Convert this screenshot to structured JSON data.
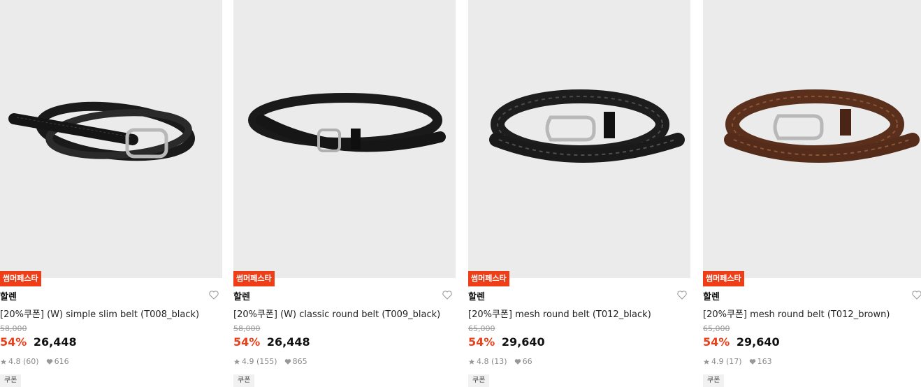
{
  "products": [
    {
      "badge": "썸머페스타",
      "brand": "할렌",
      "name": "[20%쿠폰] (W) simple slim belt (T008_black)",
      "original_price": "58,000",
      "discount": "54%",
      "price": "26,448",
      "rating": "4.8",
      "reviews": "(60)",
      "likes": "616",
      "coupon": "쿠폰",
      "image_icon": "black-slim-belt-image"
    },
    {
      "badge": "썸머페스타",
      "brand": "할렌",
      "name": "[20%쿠폰] (W) classic round belt (T009_black)",
      "original_price": "58,000",
      "discount": "54%",
      "price": "26,448",
      "rating": "4.9",
      "reviews": "(155)",
      "likes": "865",
      "coupon": "쿠폰",
      "image_icon": "black-classic-belt-image"
    },
    {
      "badge": "썸머페스타",
      "brand": "할렌",
      "name": "[20%쿠폰] mesh round belt (T012_black)",
      "original_price": "65,000",
      "discount": "54%",
      "price": "29,640",
      "rating": "4.8",
      "reviews": "(13)",
      "likes": "66",
      "coupon": "쿠폰",
      "image_icon": "black-mesh-belt-image"
    },
    {
      "badge": "썸머페스타",
      "brand": "할렌",
      "name": "[20%쿠폰] mesh round belt (T012_brown)",
      "original_price": "65,000",
      "discount": "54%",
      "price": "29,640",
      "rating": "4.9",
      "reviews": "(17)",
      "likes": "163",
      "coupon": "쿠폰",
      "image_icon": "brown-mesh-belt-image"
    }
  ],
  "colors": {
    "accent": "#ee3d17",
    "image_bg": "#ebebeb",
    "black_leather": "#1c1c1c",
    "brown_leather": "#5a2f1c"
  }
}
